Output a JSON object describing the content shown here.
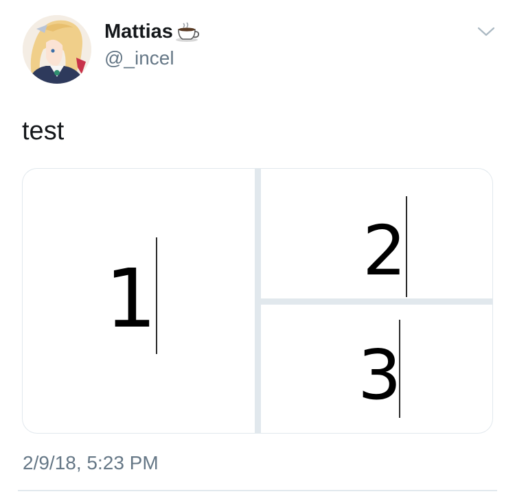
{
  "tweet": {
    "author": {
      "display_name": "Mattias",
      "handle": "@_incel",
      "name_emoji": "coffee-icon",
      "avatar": "anime-avatar"
    },
    "text": "test",
    "media": [
      {
        "label": "1"
      },
      {
        "label": "2"
      },
      {
        "label": "3"
      }
    ],
    "timestamp": "2/9/18, 5:23 PM",
    "menu_icon": "chevron-down-icon"
  },
  "colors": {
    "text_primary": "#14171a",
    "text_secondary": "#657786",
    "border": "#e1e8ed",
    "background": "#ffffff"
  }
}
